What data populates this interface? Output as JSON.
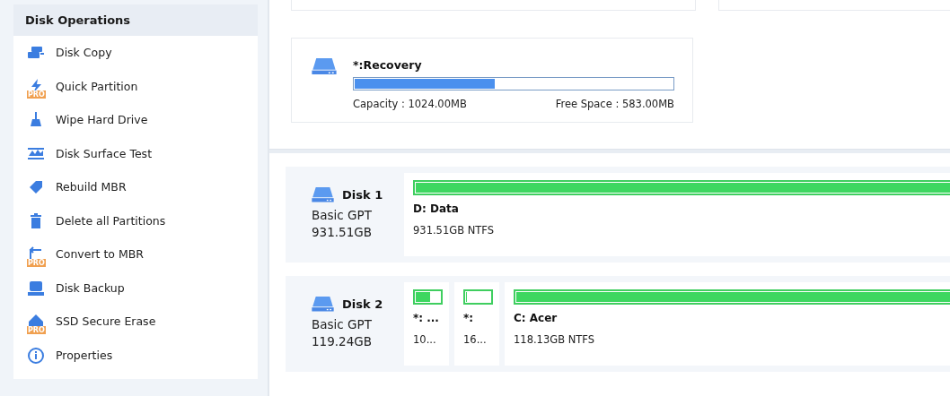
{
  "sidebar": {
    "title": "Disk Operations",
    "items": [
      {
        "label": "Disk Copy"
      },
      {
        "label": "Quick Partition",
        "badge": "PRO"
      },
      {
        "label": "Wipe Hard Drive"
      },
      {
        "label": "Disk Surface Test"
      },
      {
        "label": "Rebuild MBR"
      },
      {
        "label": "Delete all Partitions"
      },
      {
        "label": "Convert to MBR",
        "badge": "PRO"
      },
      {
        "label": "Disk Backup"
      },
      {
        "label": "SSD Secure Erase",
        "badge": "PRO"
      },
      {
        "label": "Properties"
      }
    ]
  },
  "volume_card": {
    "name": "*:Recovery",
    "level": 0.44,
    "capacity": "Capacity : 1024.00MB",
    "free_space": "Free Space : 583.00MB"
  },
  "disks": [
    {
      "name": "Disk 1",
      "type": "Basic GPT",
      "size": "931.51GB",
      "partitions": [
        {
          "kind": "full",
          "name": "D: Data",
          "detail": "931.51GB NTFS",
          "level": 1
        }
      ]
    },
    {
      "name": "Disk 2",
      "type": "Basic GPT",
      "size": "119.24GB",
      "partitions": [
        {
          "kind": "compact",
          "name": "*: ...",
          "detail": "10...",
          "level": 0.6
        },
        {
          "kind": "compact",
          "name": "*:",
          "detail": "16...",
          "level": 0
        },
        {
          "kind": "full",
          "name": "C: Acer",
          "detail": "118.13GB NTFS",
          "level": 1
        }
      ]
    }
  ]
}
